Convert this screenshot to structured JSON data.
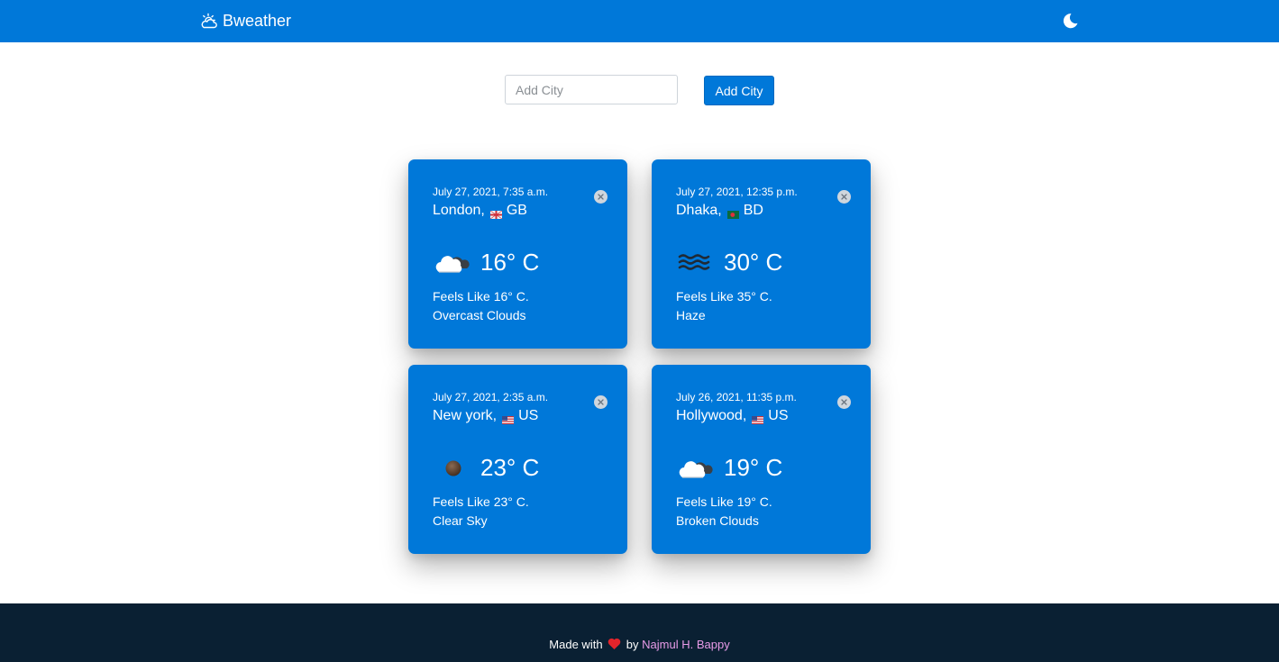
{
  "header": {
    "brand": "Bweather",
    "brand_icon": "cloud-sun-icon",
    "theme_icon": "moon-icon",
    "background": "#0078d9"
  },
  "add_city": {
    "placeholder": "Add City",
    "value": "",
    "button_label": "Add City"
  },
  "cards": [
    {
      "date": "July 27, 2021, 7:35 a.m.",
      "city": "London,",
      "country": "GB",
      "flag_icon": "flag-gb-icon",
      "weather_icon": "overcast-clouds-icon",
      "temperature": "16° C",
      "feels_like": "Feels Like 16° C.",
      "description": "Overcast Clouds"
    },
    {
      "date": "July 27, 2021, 12:35 p.m.",
      "city": "Dhaka,",
      "country": "BD",
      "flag_icon": "flag-bd-icon",
      "weather_icon": "haze-icon",
      "temperature": "30° C",
      "feels_like": "Feels Like 35° C.",
      "description": "Haze"
    },
    {
      "date": "July 27, 2021, 2:35 a.m.",
      "city": "New york,",
      "country": "US",
      "flag_icon": "flag-us-icon",
      "weather_icon": "clear-sky-night-icon",
      "temperature": "23° C",
      "feels_like": "Feels Like 23° C.",
      "description": "Clear Sky"
    },
    {
      "date": "July 26, 2021, 11:35 p.m.",
      "city": "Hollywood,",
      "country": "US",
      "flag_icon": "flag-us-icon",
      "weather_icon": "broken-clouds-icon",
      "temperature": "19° C",
      "feels_like": "Feels Like 19° C.",
      "description": "Broken Clouds"
    }
  ],
  "footer": {
    "made_with": "Made with",
    "heart_icon": "heart-icon",
    "by": "by",
    "author": "Najmul H. Bappy",
    "background": "#0a2033",
    "author_color": "#e89be8"
  }
}
